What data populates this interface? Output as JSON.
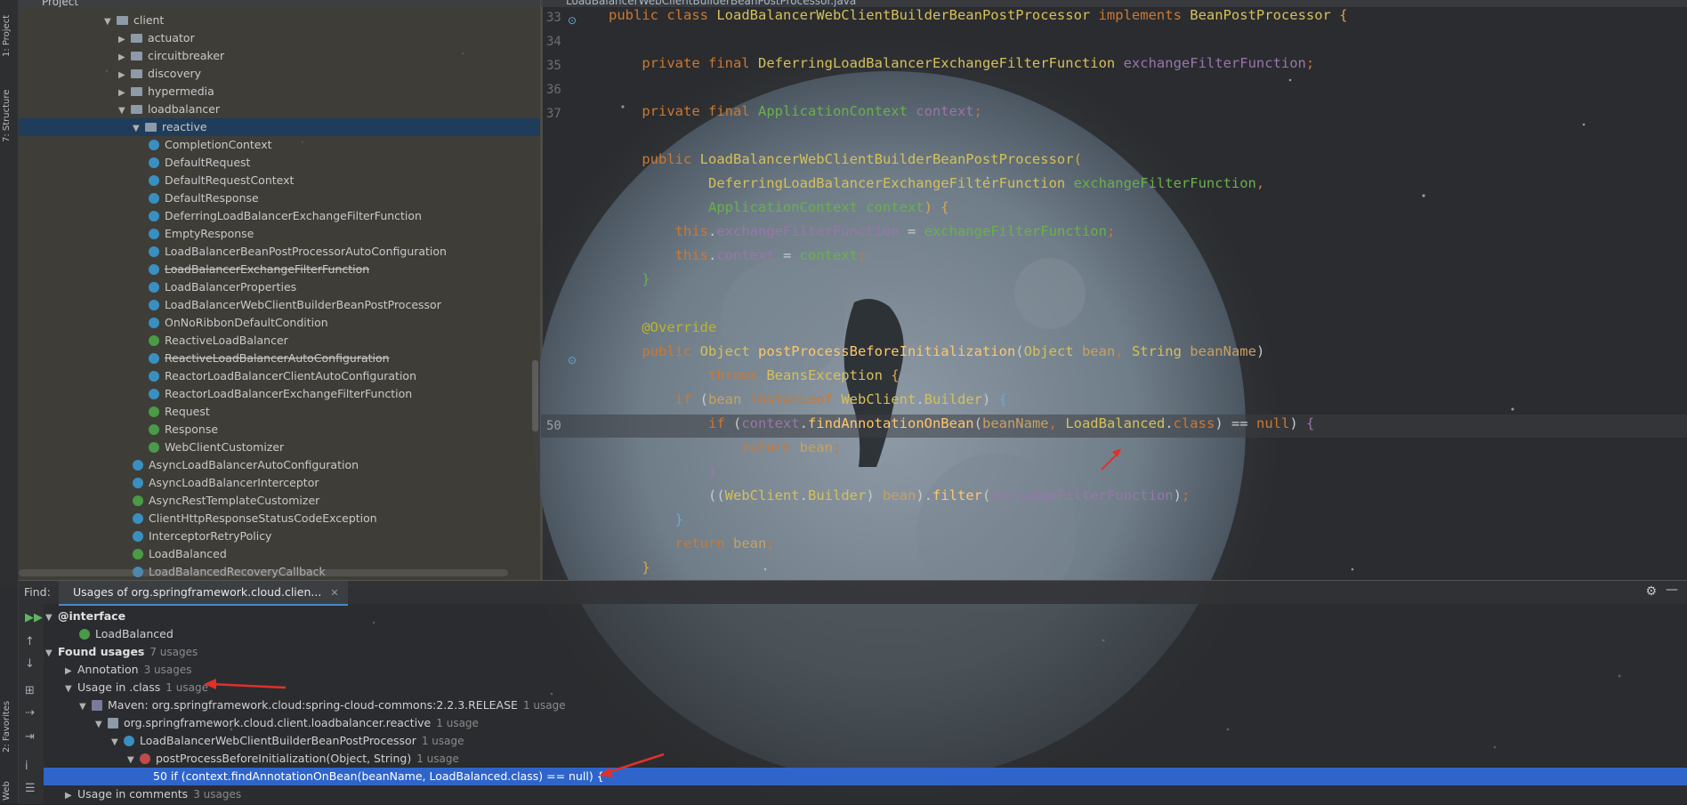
{
  "project": {
    "header": "Project",
    "tree": [
      {
        "label": "client",
        "kind": "folder",
        "expanded": true,
        "indent": 0
      },
      {
        "label": "actuator",
        "kind": "folder",
        "expanded": false,
        "indent": 1
      },
      {
        "label": "circuitbreaker",
        "kind": "folder",
        "expanded": false,
        "indent": 1
      },
      {
        "label": "discovery",
        "kind": "folder",
        "expanded": false,
        "indent": 1
      },
      {
        "label": "hypermedia",
        "kind": "folder",
        "expanded": false,
        "indent": 1
      },
      {
        "label": "loadbalancer",
        "kind": "folder",
        "expanded": true,
        "indent": 1
      },
      {
        "label": "reactive",
        "kind": "folder",
        "expanded": true,
        "indent": 2,
        "selected": true
      },
      {
        "label": "CompletionContext",
        "kind": "class",
        "indent": 3
      },
      {
        "label": "DefaultRequest",
        "kind": "class",
        "indent": 3
      },
      {
        "label": "DefaultRequestContext",
        "kind": "class",
        "indent": 3
      },
      {
        "label": "DefaultResponse",
        "kind": "class",
        "indent": 3
      },
      {
        "label": "DeferringLoadBalancerExchangeFilterFunction",
        "kind": "class",
        "indent": 3
      },
      {
        "label": "EmptyResponse",
        "kind": "class",
        "indent": 3
      },
      {
        "label": "LoadBalancerBeanPostProcessorAutoConfiguration",
        "kind": "class",
        "indent": 3
      },
      {
        "label": "LoadBalancerExchangeFilterFunction",
        "kind": "class",
        "indent": 3,
        "strike": true
      },
      {
        "label": "LoadBalancerProperties",
        "kind": "class",
        "indent": 3
      },
      {
        "label": "LoadBalancerWebClientBuilderBeanPostProcessor",
        "kind": "class",
        "indent": 3
      },
      {
        "label": "OnNoRibbonDefaultCondition",
        "kind": "class",
        "indent": 3
      },
      {
        "label": "ReactiveLoadBalancer",
        "kind": "interface",
        "indent": 3
      },
      {
        "label": "ReactiveLoadBalancerAutoConfiguration",
        "kind": "class",
        "indent": 3,
        "strike": true
      },
      {
        "label": "ReactorLoadBalancerClientAutoConfiguration",
        "kind": "class",
        "indent": 3
      },
      {
        "label": "ReactorLoadBalancerExchangeFilterFunction",
        "kind": "class",
        "indent": 3
      },
      {
        "label": "Request",
        "kind": "interface",
        "indent": 3
      },
      {
        "label": "Response",
        "kind": "interface",
        "indent": 3
      },
      {
        "label": "WebClientCustomizer",
        "kind": "interface",
        "indent": 3
      },
      {
        "label": "AsyncLoadBalancerAutoConfiguration",
        "kind": "class",
        "indent": 2
      },
      {
        "label": "AsyncLoadBalancerInterceptor",
        "kind": "class",
        "indent": 2
      },
      {
        "label": "AsyncRestTemplateCustomizer",
        "kind": "interface",
        "indent": 2
      },
      {
        "label": "ClientHttpResponseStatusCodeException",
        "kind": "class",
        "indent": 2
      },
      {
        "label": "InterceptorRetryPolicy",
        "kind": "class",
        "indent": 2
      },
      {
        "label": "LoadBalanced",
        "kind": "interface",
        "indent": 2
      },
      {
        "label": "LoadBalancedRecoveryCallback",
        "kind": "class",
        "indent": 2
      }
    ]
  },
  "sidetabs": {
    "project": "1: Project",
    "structure": "7: Structure",
    "favorites": "2: Favorites",
    "web": "Web"
  },
  "editor": {
    "tab_title": "LoadBalancerWebClientBuilderBeanPostProcessor.java",
    "line_numbers": [
      "33",
      "34",
      "35",
      "36",
      "37",
      "",
      "",
      "",
      "",
      "",
      "",
      "",
      "",
      "",
      "",
      "",
      "",
      "50"
    ]
  },
  "find": {
    "label": "Find:",
    "tab": "Usages of org.springframework.cloud.clien...",
    "rows": [
      {
        "text": "@interface",
        "bold": true,
        "arrow": "▼",
        "indent": 0
      },
      {
        "text": "LoadBalanced",
        "icon": "green",
        "indent": 2
      },
      {
        "text": "Found usages",
        "bold": true,
        "count": "7 usages",
        "arrow": "▼",
        "indent": 0
      },
      {
        "text": "Annotation",
        "count": "3 usages",
        "arrow": "▶",
        "indent": 1
      },
      {
        "text": "Usage in .class",
        "count": "1 usage",
        "arrow": "▼",
        "indent": 1
      },
      {
        "text": "Maven: org.springframework.cloud:spring-cloud-commons:2.2.3.RELEASE",
        "count": "1 usage",
        "arrow": "▼",
        "icon": "mvn",
        "indent": 2
      },
      {
        "text": "org.springframework.cloud.client.loadbalancer.reactive",
        "count": "1 usage",
        "arrow": "▼",
        "icon": "pkg",
        "indent": 3
      },
      {
        "text": "LoadBalancerWebClientBuilderBeanPostProcessor",
        "count": "1 usage",
        "arrow": "▼",
        "icon": "cls",
        "indent": 4
      },
      {
        "text": "postProcessBeforeInitialization(Object, String)",
        "count": "1 usage",
        "arrow": "▼",
        "icon": "m",
        "indent": 5
      },
      {
        "text": "50 if (context.findAnnotationOnBean(beanName, LoadBalanced.class) == null) {",
        "selected": true,
        "indent": 7
      },
      {
        "text": "Usage in comments",
        "count": "3 usages",
        "arrow": "▶",
        "indent": 1
      }
    ]
  }
}
